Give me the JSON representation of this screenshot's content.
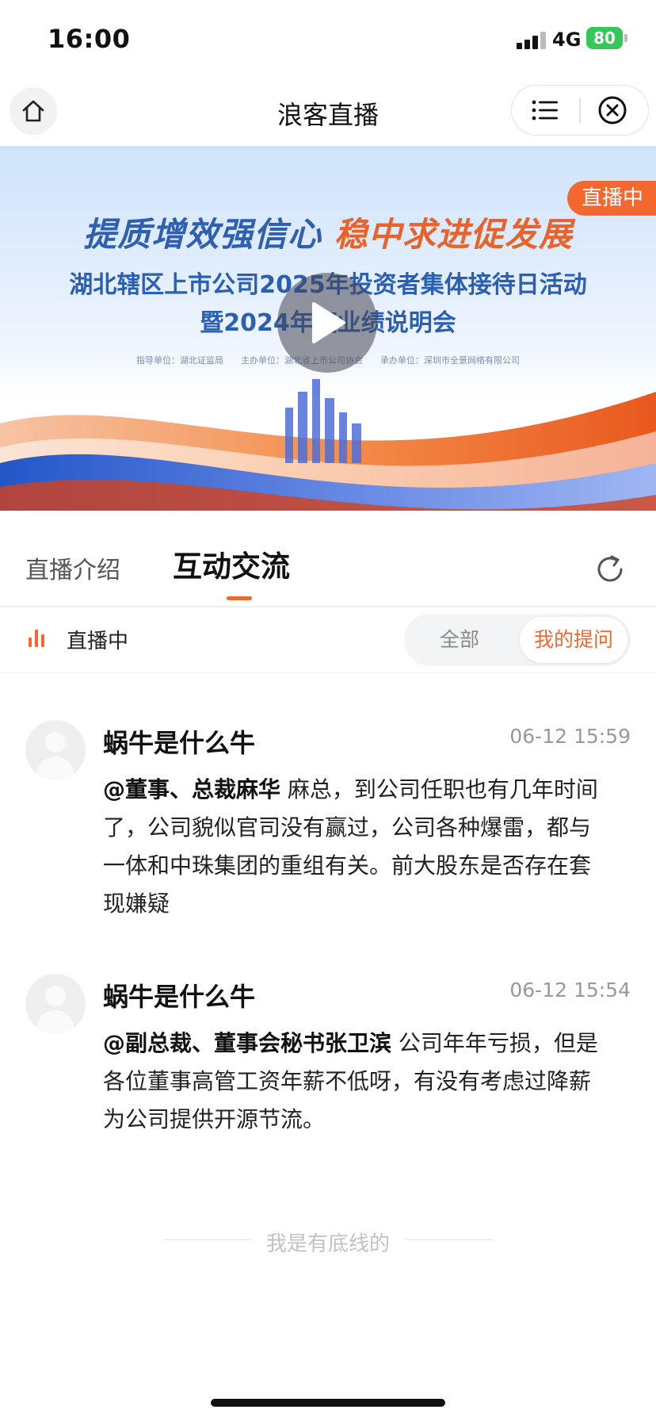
{
  "status_bar": {
    "time": "16:00",
    "network": "4G",
    "battery": "80"
  },
  "nav": {
    "title": "浪客直播"
  },
  "banner": {
    "badge": "直播中",
    "slogan_left": "提质增效强信心",
    "slogan_right": "稳中求进促发展",
    "title_line1": "湖北辖区上市公司2025年投资者集体接待日活动",
    "title_line2": "暨2024年度业绩说明会",
    "meta": "指导单位：湖北证监局　　主办单位：湖北省上市公司协会　　承办单位：深圳市全景网络有限公司"
  },
  "tabs": {
    "intro": "直播介绍",
    "chat": "互动交流"
  },
  "filter": {
    "status": "直播中",
    "all": "全部",
    "mine": "我的提问"
  },
  "comments": [
    {
      "name": "蜗牛是什么牛",
      "time": "06-12 15:59",
      "mention": "@董事、总裁麻华",
      "text": " 麻总，到公司任职也有几年时间了，公司貌似官司没有赢过，公司各种爆雷，都与一体和中珠集团的重组有关。前大股东是否存在套现嫌疑"
    },
    {
      "name": "蜗牛是什么牛",
      "time": "06-12 15:54",
      "mention": "@副总裁、董事会秘书张卫滨",
      "text": " 公司年年亏损，但是各位董事高管工资年薪不低呀，有没有考虑过降薪为公司提供开源节流。"
    }
  ],
  "footer": {
    "text": "我是有底线的"
  },
  "colors": {
    "accent": "#f4672e",
    "battery": "#34c759"
  }
}
